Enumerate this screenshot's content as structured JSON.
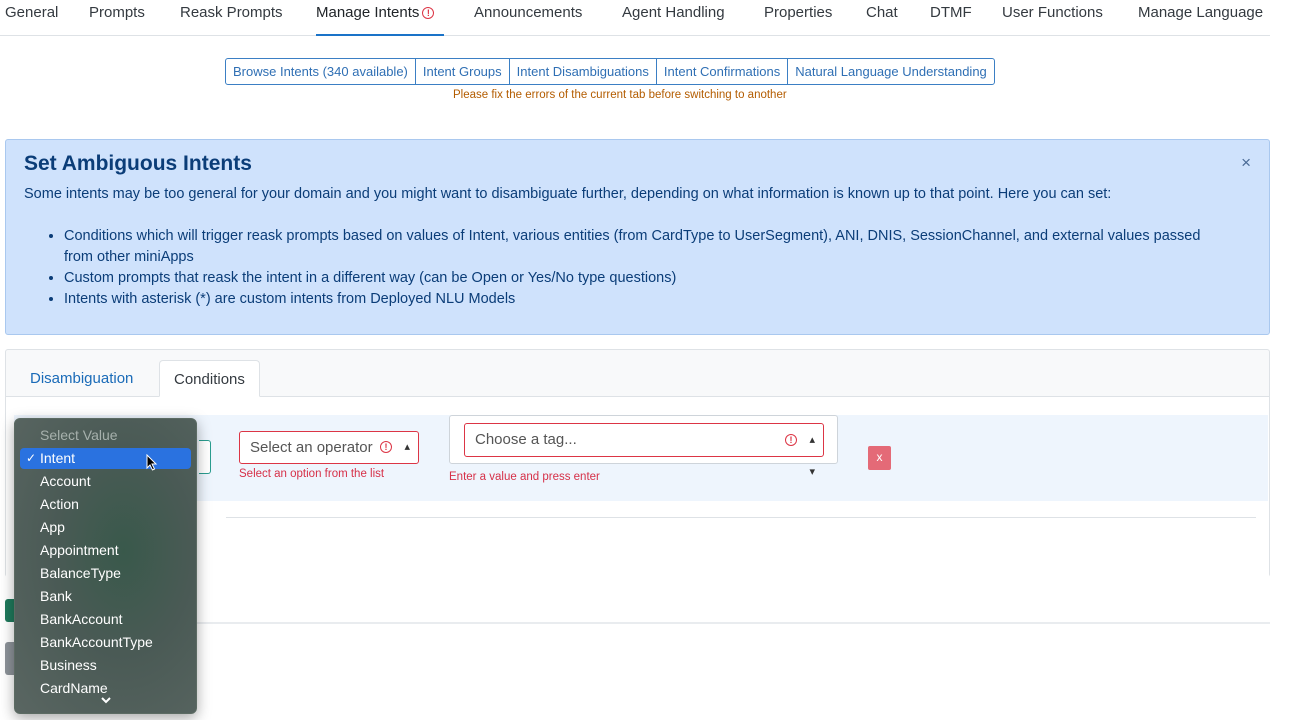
{
  "top_nav": {
    "items": [
      {
        "label": "General"
      },
      {
        "label": "Prompts"
      },
      {
        "label": "Reask Prompts"
      },
      {
        "label": "Manage Intents"
      },
      {
        "label": "Announcements"
      },
      {
        "label": "Agent Handling"
      },
      {
        "label": "Properties"
      },
      {
        "label": "Chat"
      },
      {
        "label": "DTMF"
      },
      {
        "label": "User Functions"
      },
      {
        "label": "Manage Language"
      }
    ],
    "active": "Manage Intents"
  },
  "sub_tabs": {
    "items": [
      {
        "label": "Browse Intents (340 available)"
      },
      {
        "label": "Intent Groups"
      },
      {
        "label": "Intent Disambiguations"
      },
      {
        "label": "Intent Confirmations"
      },
      {
        "label": "Natural Language Understanding"
      }
    ],
    "warning": "Please fix the errors of the current tab before switching to another"
  },
  "alert": {
    "title": "Set Ambiguous Intents",
    "close": "×",
    "intro": "Some intents may be too general for your domain and you might want to disambiguate further, depending on what information is known up to that point. Here you can set:",
    "bullets": [
      "Conditions which will trigger reask prompts based on values of Intent, various entities (from CardType to UserSegment), ANI, DNIS, SessionChannel, and external values passed from other miniApps",
      "Custom prompts that reask the intent in a different way (can be Open or Yes/No type questions)",
      "Intents with asterisk (*) are custom intents from Deployed NLU Models"
    ]
  },
  "card": {
    "tabs": [
      {
        "label": "Disambiguation"
      },
      {
        "label": "Conditions"
      }
    ],
    "active_tab": "Conditions",
    "condition": {
      "operator_placeholder": "Select an operator",
      "operator_help": "Select an option from the list",
      "tag_placeholder": "Choose a tag...",
      "tag_help": "Enter a value and press enter",
      "remove_label": "x"
    }
  },
  "dropdown": {
    "placeholder": "Select Value",
    "selected": "Intent",
    "options": [
      "Intent",
      "Account",
      "Action",
      "App",
      "Appointment",
      "BalanceType",
      "Bank",
      "BankAccount",
      "BankAccountType",
      "Business",
      "CardName"
    ],
    "check_icon": "✓",
    "more_icon": "⌄"
  },
  "colors": {
    "accent": "#1a73c8",
    "error": "#dc3545",
    "alert_bg": "#cfe2fc",
    "dropdown_selected": "#2a72e0"
  }
}
